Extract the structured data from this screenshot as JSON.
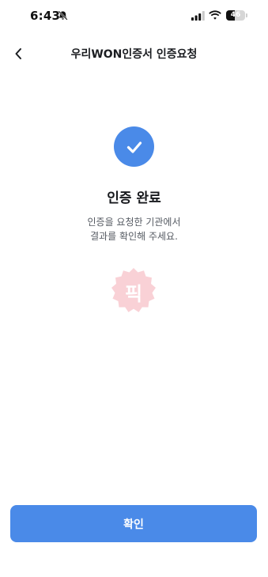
{
  "status_bar": {
    "time": "6:43",
    "battery": "46",
    "battery_level_percent": 46,
    "icons": [
      "bell-slash-icon",
      "signal-icon",
      "wifi-icon",
      "battery-icon"
    ]
  },
  "header": {
    "back_icon": "chevron-left-icon",
    "title": "우리WON인증서 인증요청"
  },
  "result": {
    "icon": "checkmark-icon",
    "title": "인증 완료",
    "message_line1": "인증을 요청한 기관에서",
    "message_line2": "결과를 확인해 주세요."
  },
  "watermark": {
    "text": "픽"
  },
  "footer": {
    "confirm_label": "확인"
  },
  "colors": {
    "accent": "#4a8ae8",
    "text_primary": "#17191d",
    "text_secondary": "#555a62",
    "watermark": "#e5344a"
  }
}
